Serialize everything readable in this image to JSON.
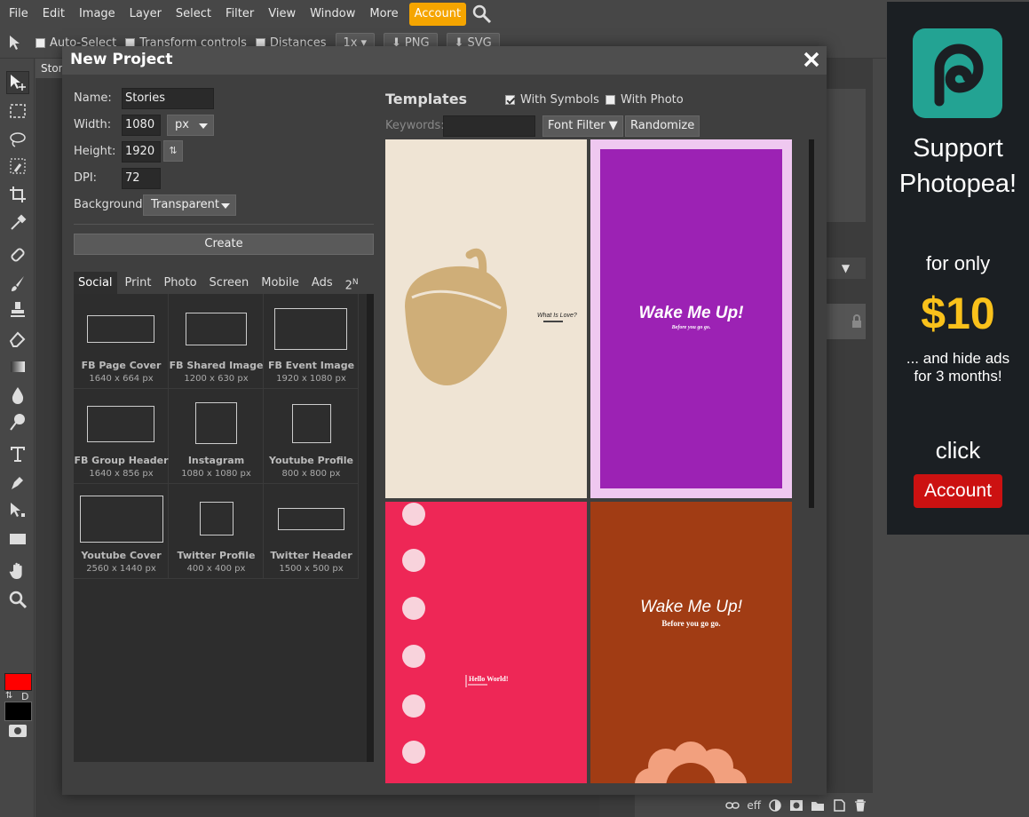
{
  "menu": {
    "items": [
      "File",
      "Edit",
      "Image",
      "Layer",
      "Select",
      "Filter",
      "View",
      "Window",
      "More"
    ],
    "account": "Account"
  },
  "options": {
    "auto_select": "Auto-Select",
    "transform_controls": "Transform controls",
    "distances": "Distances",
    "zoom": "1x",
    "png": "PNG",
    "svg": "SVG"
  },
  "doc_tab": "Stor",
  "dialog": {
    "title": "New Project",
    "name_label": "Name:",
    "name_value": "Stories",
    "width_label": "Width:",
    "width_value": "1080",
    "unit": "px",
    "height_label": "Height:",
    "height_value": "1920",
    "dpi_label": "DPI:",
    "dpi_value": "72",
    "background_label": "Background:",
    "background_value": "Transparent",
    "create": "Create",
    "tabs": [
      "Social",
      "Print",
      "Photo",
      "Screen",
      "Mobile",
      "Ads",
      "2"
    ],
    "tab_sup": "N",
    "presets": [
      {
        "name": "FB Page Cover",
        "size": "1640 x 664 px"
      },
      {
        "name": "FB Shared Image",
        "size": "1200 x 630 px"
      },
      {
        "name": "FB Event Image",
        "size": "1920 x 1080 px"
      },
      {
        "name": "FB Group Header",
        "size": "1640 x 856 px"
      },
      {
        "name": "Instagram",
        "size": "1080 x 1080 px"
      },
      {
        "name": "Youtube Profile",
        "size": "800 x 800 px"
      },
      {
        "name": "Youtube Cover",
        "size": "2560 x 1440 px"
      },
      {
        "name": "Twitter Profile",
        "size": "400 x 400 px"
      },
      {
        "name": "Twitter Header",
        "size": "1500 x 500 px"
      }
    ],
    "templates": {
      "title": "Templates",
      "with_symbols": "With Symbols",
      "with_photo": "With Photo",
      "keywords_label": "Keywords:",
      "font_filter": "Font Filter ▼",
      "randomize": "Randomize",
      "cards": [
        {
          "title": "What Is Love?",
          "colors": {
            "bg": "#efe4d4",
            "shape": "#cfae78"
          }
        },
        {
          "title": "Wake Me Up!",
          "subtitle": "Before you go go.",
          "colors": {
            "bg": "#9c22b4",
            "border": "#efc8f0"
          }
        },
        {
          "title": "Hello World!",
          "colors": {
            "bg": "#ee2756",
            "dots": "#f8d3dc"
          }
        },
        {
          "title": "Wake Me Up!",
          "subtitle": "Before you go go.",
          "colors": {
            "bg": "#a13c14",
            "flower": "#f2a07e"
          }
        }
      ]
    }
  },
  "bottom": {
    "eff": "eff"
  },
  "ad": {
    "line1": "Support",
    "line2": "Photopea!",
    "for_only": "for only",
    "price": "$10",
    "hide1": "... and hide ads",
    "hide2": "for 3 months!",
    "click": "click",
    "account": "Account"
  },
  "colors": {
    "accent": "#f5a500",
    "fg_color": "#ff0000",
    "bg_color": "#000000",
    "ad_price": "#f9c11b",
    "ad_button": "#cc1111"
  }
}
